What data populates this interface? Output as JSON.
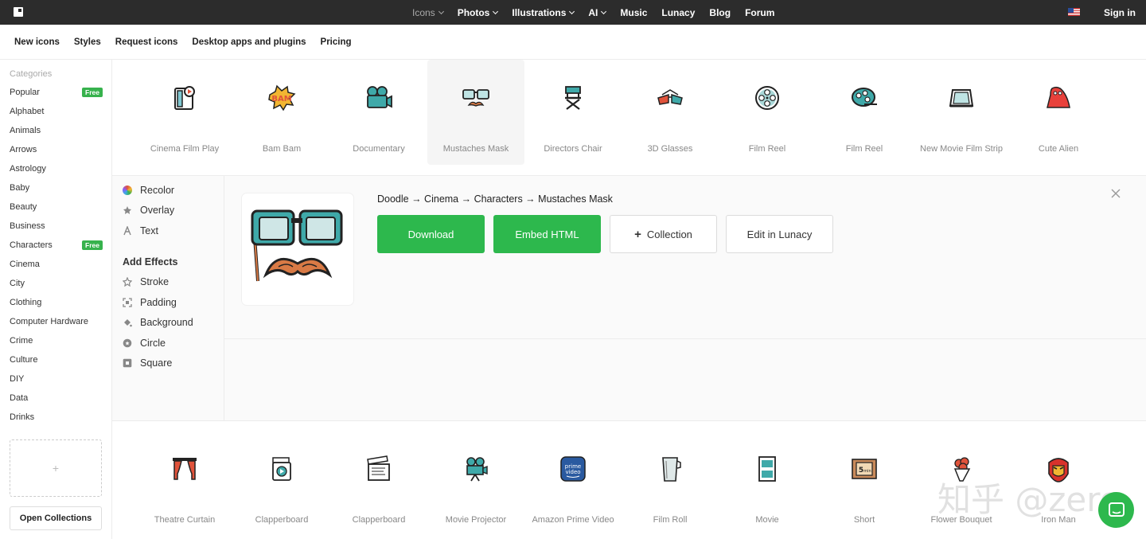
{
  "topbar": {
    "nav": [
      {
        "label": "Icons",
        "dropdown": true,
        "dim": true
      },
      {
        "label": "Photos",
        "dropdown": true
      },
      {
        "label": "Illustrations",
        "dropdown": true
      },
      {
        "label": "AI",
        "dropdown": true
      },
      {
        "label": "Music"
      },
      {
        "label": "Lunacy"
      },
      {
        "label": "Blog"
      },
      {
        "label": "Forum"
      }
    ],
    "sign_in": "Sign in"
  },
  "subnav": [
    "New icons",
    "Styles",
    "Request icons",
    "Desktop apps and plugins",
    "Pricing"
  ],
  "sidebar": {
    "heading": "Categories",
    "items": [
      {
        "label": "Popular",
        "badge": "Free"
      },
      {
        "label": "Alphabet"
      },
      {
        "label": "Animals"
      },
      {
        "label": "Arrows"
      },
      {
        "label": "Astrology"
      },
      {
        "label": "Baby"
      },
      {
        "label": "Beauty"
      },
      {
        "label": "Business"
      },
      {
        "label": "Characters",
        "badge": "Free"
      },
      {
        "label": "Cinema"
      },
      {
        "label": "City"
      },
      {
        "label": "Clothing"
      },
      {
        "label": "Computer Hardware"
      },
      {
        "label": "Crime"
      },
      {
        "label": "Culture"
      },
      {
        "label": "DIY"
      },
      {
        "label": "Data"
      },
      {
        "label": "Drinks"
      }
    ],
    "collection_add": "+",
    "open_collections": "Open Collections"
  },
  "icons_top": [
    {
      "label": "Cinema Film Play",
      "icon": "film-play-icon"
    },
    {
      "label": "Bam Bam",
      "icon": "bam-icon"
    },
    {
      "label": "Documentary",
      "icon": "camera-icon"
    },
    {
      "label": "Mustaches Mask",
      "icon": "mustache-mask-icon",
      "selected": true
    },
    {
      "label": "Directors Chair",
      "icon": "chair-icon"
    },
    {
      "label": "3D Glasses",
      "icon": "3d-glasses-icon"
    },
    {
      "label": "Film Reel",
      "icon": "film-reel-icon"
    },
    {
      "label": "Film Reel",
      "icon": "film-reel-2-icon"
    },
    {
      "label": "New Movie Film Strip",
      "icon": "film-strip-icon"
    },
    {
      "label": "Cute Alien",
      "icon": "alien-icon"
    }
  ],
  "icons_bottom": [
    {
      "label": "Theatre Curtain",
      "icon": "curtain-icon"
    },
    {
      "label": "Clapperboard",
      "icon": "clapperboard-icon"
    },
    {
      "label": "Clapperboard",
      "icon": "clapperboard-2-icon"
    },
    {
      "label": "Movie Projector",
      "icon": "projector-icon"
    },
    {
      "label": "Amazon Prime Video",
      "icon": "prime-video-icon"
    },
    {
      "label": "Film Roll",
      "icon": "film-roll-icon"
    },
    {
      "label": "Movie",
      "icon": "movie-icon"
    },
    {
      "label": "Short",
      "icon": "short-icon"
    },
    {
      "label": "Flower Bouquet",
      "icon": "bouquet-icon"
    },
    {
      "label": "Iron Man",
      "icon": "iron-man-icon"
    }
  ],
  "editor": {
    "tools": [
      "Recolor",
      "Overlay",
      "Text"
    ],
    "effects_title": "Add Effects",
    "effects": [
      "Stroke",
      "Padding",
      "Background",
      "Circle",
      "Square"
    ],
    "breadcrumb": "Doodle → Cinema → Characters → Mustaches Mask",
    "download": "Download",
    "embed": "Embed HTML",
    "collection_plus": "+",
    "collection": "Collection",
    "lunacy": "Edit in Lunacy"
  },
  "watermark": "知乎 @zero",
  "colors": {
    "accent": "#2db84d",
    "topbar": "#2c2c2c",
    "badge": "#37b24d"
  }
}
